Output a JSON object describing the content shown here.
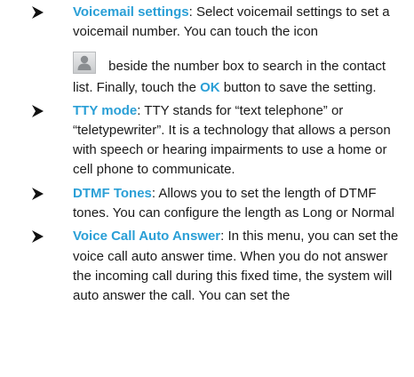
{
  "items": [
    {
      "term": "Voicemail settings",
      "text_a": ": Select voicemail settings to set a voicemail number. You can touch the icon",
      "icon": "contact-person-icon",
      "text_b": " beside the number box to search in the contact list. Finally, touch the ",
      "ok": "OK",
      "text_c": " button to save the setting."
    },
    {
      "term": "TTY mode",
      "text": ": TTY stands for “text telephone” or “teletypewriter”. It is a technology that allows a person with speech or hearing impairments to use a home or cell phone to communicate."
    },
    {
      "term": "DTMF Tones",
      "text": ": Allows you to set the length of DTMF tones. You can configure the length as Long or Normal"
    },
    {
      "term": "Voice Call Auto Answer",
      "text": ": In this menu, you can set the voice call auto answer time. When you do not answer the incoming call during this fixed time, the system will auto answer the call. You can set the"
    }
  ],
  "colors": {
    "term": "#2a9fd6",
    "body_text": "#1a1a1a"
  }
}
